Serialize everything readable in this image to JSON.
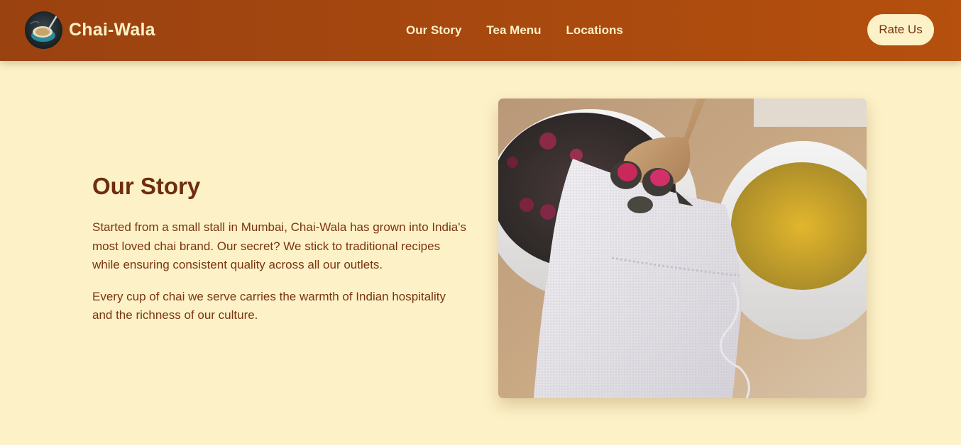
{
  "header": {
    "brand_name": "Chai-Wala",
    "logo_icon": "chai-cup-logo-icon",
    "nav": [
      {
        "label": "Our Story"
      },
      {
        "label": "Tea Menu"
      },
      {
        "label": "Locations"
      }
    ],
    "rate_button_label": "Rate Us"
  },
  "story": {
    "title": "Our Story",
    "paragraphs": [
      "Started from a small stall in Mumbai, Chai-Wala has grown into India's most loved chai brand. Our secret? We stick to traditional recipes while ensuring consistent quality across all our outlets.",
      "Every cup of chai we serve carries the warmth of Indian hospitality and the richness of our culture."
    ],
    "image_icon": "tea-bag-with-rose-buds-photo"
  },
  "colors": {
    "header_start": "#9a4210",
    "header_end": "#b5500e",
    "page_background": "#fdf1c7",
    "title_color": "#6e2d0e",
    "text_color": "#7a3410",
    "button_background": "#fdf1c7"
  }
}
